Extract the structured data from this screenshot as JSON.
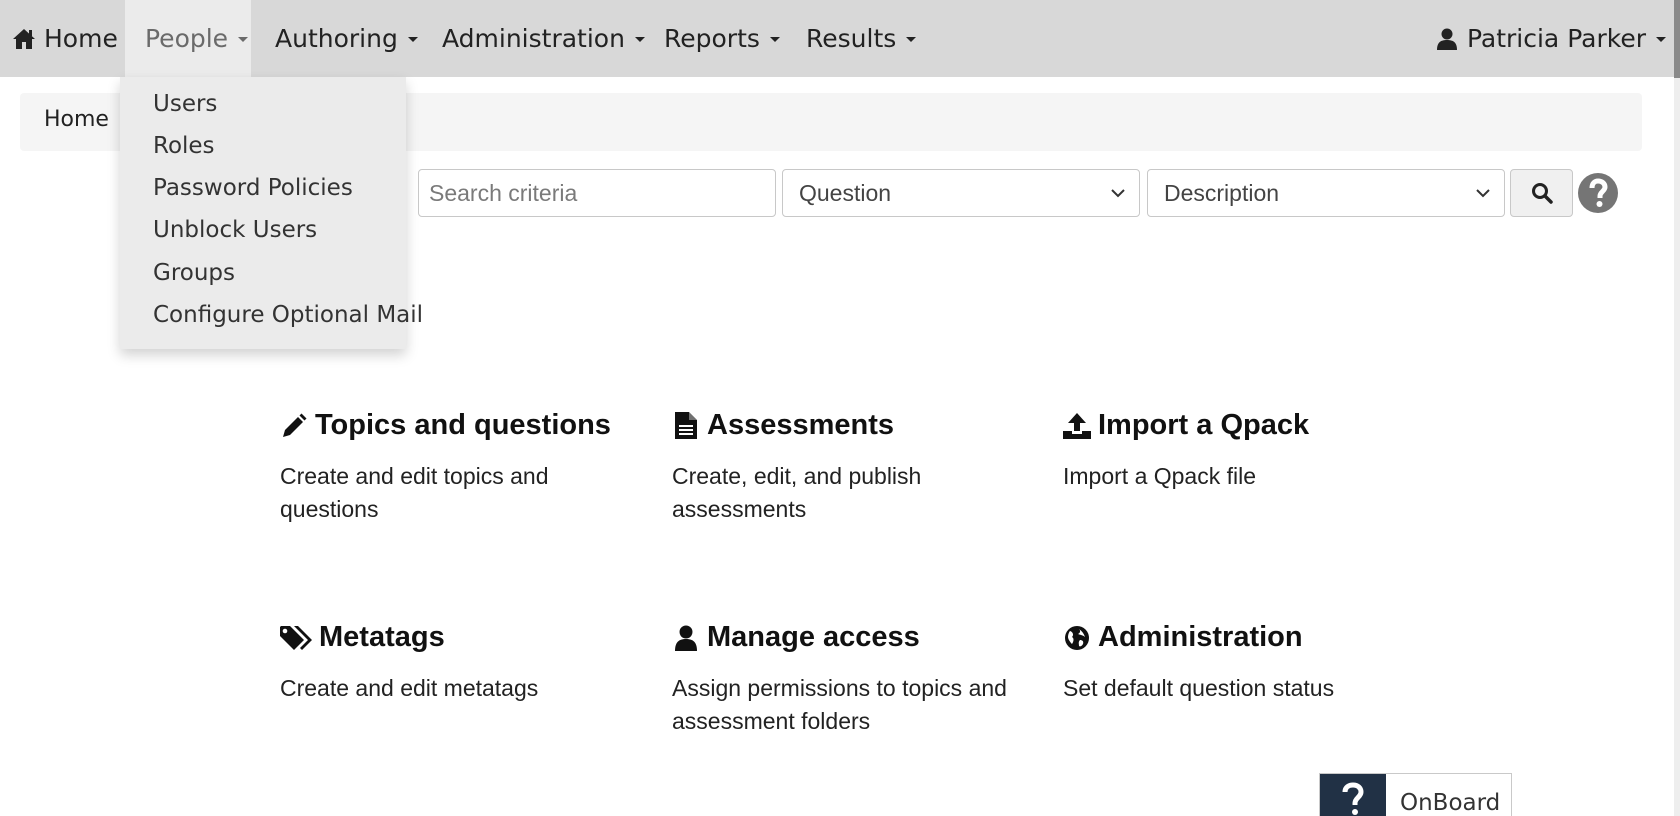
{
  "nav": {
    "home": "Home",
    "people": "People",
    "authoring": "Authoring",
    "administration": "Administration",
    "reports": "Reports",
    "results": "Results",
    "user": "Patricia Parker"
  },
  "people_menu": {
    "items": [
      "Users",
      "Roles",
      "Password Policies",
      "Unblock Users",
      "Groups",
      "Configure Optional Mail"
    ]
  },
  "breadcrumb": {
    "home": "Home"
  },
  "search": {
    "placeholder": "Search criteria",
    "type_selected": "Question",
    "field_selected": "Description"
  },
  "tiles": [
    {
      "title": "Topics and questions",
      "desc": "Create and edit topics and questions",
      "icon": "pencil-icon"
    },
    {
      "title": "Assessments",
      "desc": "Create, edit, and publish assessments",
      "icon": "document-icon"
    },
    {
      "title": "Import a Qpack",
      "desc": "Import a Qpack file",
      "icon": "upload-icon"
    },
    {
      "title": "Metatags",
      "desc": "Create and edit metatags",
      "icon": "tags-icon"
    },
    {
      "title": "Manage access",
      "desc": "Assign permissions to topics and assessment folders",
      "icon": "user-icon"
    },
    {
      "title": "Administration",
      "desc": "Set default question status",
      "icon": "globe-icon"
    }
  ],
  "onboard": {
    "label": "OnBoard"
  },
  "colors": {
    "navbar_bg": "#d8d8d8",
    "dropdown_bg": "#ebebeb",
    "breadcrumb_bg": "#f5f5f5",
    "onboard_accent": "#213145"
  }
}
